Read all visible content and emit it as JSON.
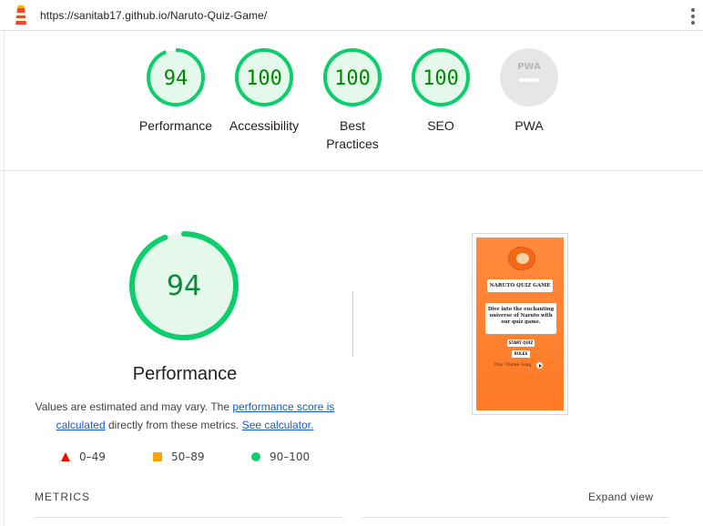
{
  "topbar": {
    "url": "https://sanitab17.github.io/Naruto-Quiz-Game/",
    "logo_icon": "lighthouse-icon",
    "menu_icon": "kebab-menu-icon"
  },
  "summary": {
    "gauges": [
      {
        "score": "94",
        "label": "Performance",
        "value": 0.94
      },
      {
        "score": "100",
        "label": "Accessibility",
        "value": 1.0
      },
      {
        "score": "100",
        "label": "Best Practices",
        "value": 1.0
      },
      {
        "score": "100",
        "label": "SEO",
        "value": 1.0
      },
      {
        "score": "PWA",
        "label": "PWA",
        "value": null
      }
    ]
  },
  "performance": {
    "score": "94",
    "value": 0.94,
    "title": "Performance",
    "note_prefix": "Values are estimated and may vary. The ",
    "note_link1": "performance score is calculated",
    "note_middle": " directly from these metrics. ",
    "note_link2": "See calculator.",
    "legend": [
      {
        "shape": "triangle",
        "range": "0–49",
        "color": "#eb0f00"
      },
      {
        "shape": "square",
        "range": "50–89",
        "color": "#ffa400"
      },
      {
        "shape": "circle",
        "range": "90–100",
        "color": "#0cce6b"
      }
    ]
  },
  "screenshot": {
    "title": "NARUTO QUIZ GAME",
    "description": "Dive into the enchanting universe of Naruto with our quiz game.",
    "start_button": "START QUIZ",
    "rules_button": "RULES",
    "song_label": "Play Theme Song"
  },
  "metrics": {
    "label": "METRICS",
    "expand_label": "Expand view"
  },
  "colors": {
    "pass_green": "#0cce6b",
    "pass_text": "#008800",
    "pass_fill": "#e5f8ec",
    "pwa_gray": "#e6e6e6",
    "link_blue": "#1558d6"
  }
}
